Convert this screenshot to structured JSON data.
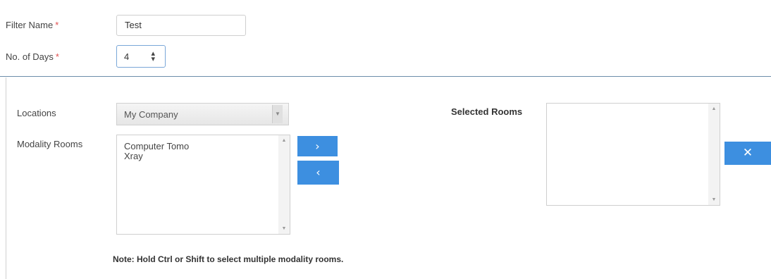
{
  "form": {
    "filter_name": {
      "label": "Filter Name",
      "required_mark": "*",
      "value": "Test"
    },
    "no_of_days": {
      "label": "No. of Days",
      "required_mark": "*",
      "value": "4",
      "spinner_icon": "updown-spinner-icon"
    },
    "locations": {
      "label": "Locations",
      "selected": "My Company"
    },
    "modality_rooms": {
      "label": "Modality Rooms",
      "items": [
        "Computer Tomo",
        "Xray"
      ]
    },
    "selected_rooms": {
      "label": "Selected Rooms",
      "items": []
    },
    "buttons": {
      "move_right": {
        "glyph": "›",
        "icon": "chevron-right-icon"
      },
      "move_left": {
        "glyph": "‹",
        "icon": "chevron-left-icon"
      },
      "clear": {
        "glyph": "✕",
        "icon": "close-icon"
      }
    },
    "note": "Note: Hold Ctrl or Shift to select multiple modality rooms."
  },
  "colors": {
    "accent_button": "#3d8fe0",
    "required_mark": "#e05050",
    "divider": "#6d8eab",
    "focused_border": "#7aa7d8"
  }
}
